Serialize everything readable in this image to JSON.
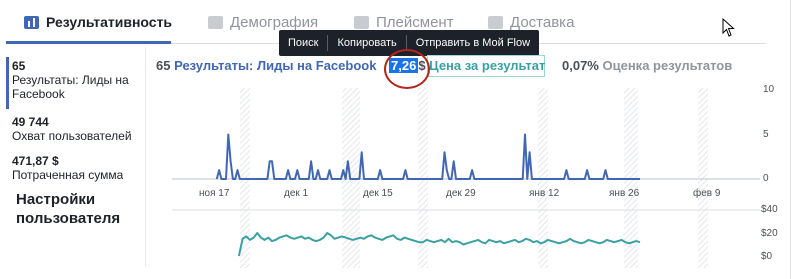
{
  "tabs": [
    {
      "label": "Результативность",
      "icon": "bar-chart-icon",
      "active": true
    },
    {
      "label": "Демография",
      "icon": "people-icon",
      "active": false
    },
    {
      "label": "Плейсмент",
      "icon": "placement-icon",
      "active": false
    },
    {
      "label": "Доставка",
      "icon": "delivery-chart-icon",
      "active": false
    }
  ],
  "context_menu": {
    "items": [
      "Поиск",
      "Копировать",
      "Отправить в Мой Flow"
    ]
  },
  "left_panel": {
    "metrics": [
      {
        "value": "65",
        "label_lines": [
          "Результаты: Лиды на",
          "Facebook"
        ]
      },
      {
        "value": "49 744",
        "label_lines": [
          "Охват пользователей"
        ]
      },
      {
        "value": "471,87 $",
        "label_lines": [
          "Потраченная сумма"
        ]
      }
    ],
    "settings_title": "Настройки пользователя"
  },
  "summary": {
    "results_count": "65",
    "results_label": "Результаты: Лиды на Facebook",
    "cost_value": "7,26",
    "cost_currency": "$",
    "cost_label": "Цена за результат",
    "rating_value": "0,07%",
    "rating_label": "Оценка результатов"
  },
  "colors": {
    "accent": "#4267b2",
    "teal": "#3aa0a0",
    "annotation_circle": "#b3261e",
    "selection": "#1a73e8"
  },
  "chart_data": [
    {
      "type": "line",
      "series": [
        {
          "values": [
            0,
            0,
            0,
            0,
            0,
            0,
            0,
            0,
            0,
            0,
            0,
            0,
            0,
            0,
            0,
            0,
            0,
            1,
            0,
            0,
            0,
            5,
            2,
            0,
            0,
            1,
            0,
            0,
            0,
            0,
            0,
            0,
            0,
            0,
            0,
            0,
            0,
            0,
            0,
            2,
            2,
            0,
            0,
            0,
            0,
            0,
            0,
            1,
            0,
            0,
            0,
            1,
            0,
            0,
            0,
            0,
            0,
            2,
            0,
            0,
            1,
            0,
            0,
            0,
            0,
            1,
            0,
            0,
            0,
            0,
            0,
            1,
            0,
            2,
            0,
            0,
            0,
            0,
            0,
            3,
            0,
            0,
            0,
            0,
            0,
            0,
            0,
            1,
            0,
            0,
            0,
            0,
            0,
            0,
            0,
            0,
            0,
            0,
            1,
            0,
            0,
            0,
            0,
            0,
            0,
            0,
            0,
            0,
            0,
            0,
            0,
            0,
            0,
            0,
            0,
            3,
            1,
            0,
            0,
            2,
            0,
            0,
            0,
            0,
            0,
            0,
            0,
            1,
            0,
            0,
            0,
            0,
            0,
            0,
            0,
            0,
            0,
            0,
            0,
            0,
            0,
            0,
            0,
            0,
            0,
            0,
            0,
            0,
            0,
            0,
            5,
            0,
            3,
            0,
            0,
            0,
            0,
            0,
            0,
            0,
            0,
            0,
            0,
            0,
            0,
            0,
            0,
            0,
            1,
            0,
            0,
            0,
            0,
            0,
            0,
            0,
            0,
            1,
            0,
            0,
            0,
            0,
            0,
            0,
            0,
            1,
            0,
            0,
            0,
            0,
            0,
            0,
            0,
            0,
            0,
            0,
            0,
            0,
            0,
            0,
            0
          ]
        }
      ],
      "x_tick_labels": [
        "ноя 17",
        "дек 1",
        "дек 15",
        "дек 29",
        "янв 12",
        "янв 26",
        "фев 9"
      ],
      "y_tick_labels": [
        "10",
        "5",
        "0"
      ],
      "ylim": [
        0,
        10
      ]
    },
    {
      "type": "line",
      "series": [
        {
          "values": [
            0,
            0,
            0,
            0,
            0,
            0,
            0,
            0,
            0,
            0,
            0,
            0,
            0,
            0,
            0,
            0,
            0,
            15,
            17,
            14,
            16,
            20,
            16,
            14,
            16,
            13,
            14,
            16,
            17,
            18,
            16,
            15,
            16,
            17,
            15,
            16,
            14,
            13,
            14,
            16,
            20,
            18,
            15,
            16,
            17,
            16,
            15,
            14,
            15,
            16,
            15,
            17,
            18,
            16,
            15,
            14,
            16,
            17,
            18,
            15,
            14,
            16,
            15,
            14,
            13,
            12,
            12,
            14,
            13,
            12,
            13,
            14,
            12,
            15,
            12,
            13,
            12,
            10,
            11,
            12,
            13,
            14,
            12,
            11,
            14,
            13,
            12,
            13,
            11,
            12,
            13,
            14,
            12,
            13,
            15,
            14,
            12,
            13,
            11,
            12,
            14,
            13,
            12,
            11,
            12,
            13,
            15,
            13,
            12,
            11,
            12,
            14,
            13,
            12,
            11,
            12,
            14,
            13,
            12,
            13,
            14,
            12,
            11,
            12,
            13,
            12
          ]
        }
      ],
      "y_tick_labels": [
        "$40",
        "$20",
        "$0"
      ],
      "ylim": [
        0,
        40
      ]
    }
  ]
}
